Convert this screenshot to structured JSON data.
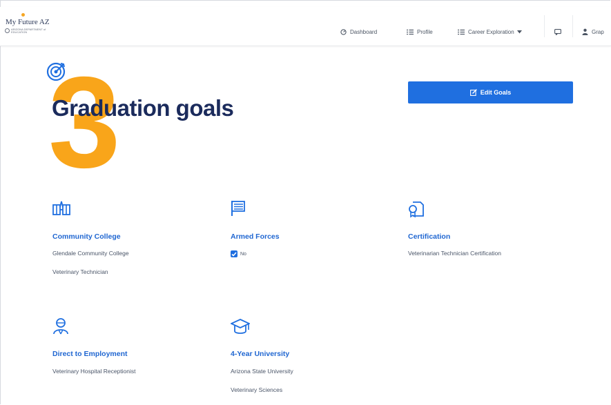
{
  "header": {
    "logo_title": "My Future AZ",
    "logo_subtitle": "ARIZONA DEPARTMENT of EDUCATION",
    "nav": [
      {
        "label": "Dashboard",
        "icon": "dashboard-icon"
      },
      {
        "label": "Profile",
        "icon": "profile-list-icon"
      },
      {
        "label": "Career Exploration",
        "icon": "career-list-icon",
        "dropdown": true
      },
      {
        "label": "",
        "icon": "chat-icon"
      },
      {
        "label": "Grap",
        "icon": "user-icon"
      }
    ]
  },
  "hero": {
    "number": "3",
    "title": "Graduation goals",
    "edit_button": "Edit Goals"
  },
  "goals": [
    {
      "icon": "community-college-icon",
      "title": "Community College",
      "lines": [
        "Glendale Community College",
        "Veterinary Technician"
      ]
    },
    {
      "icon": "armed-forces-flag-icon",
      "title": "Armed Forces",
      "checkbox": {
        "checked": true,
        "label": "No"
      }
    },
    {
      "icon": "certification-icon",
      "title": "Certification",
      "lines": [
        "Veterinarian Technician Certification"
      ]
    },
    {
      "icon": "employment-icon",
      "title": "Direct to Employment",
      "lines": [
        "Veterinary Hospital Receptionist"
      ]
    },
    {
      "icon": "graduation-cap-icon",
      "title": "4-Year University",
      "lines": [
        "Arizona State University",
        "Veterinary Sciences"
      ]
    }
  ],
  "colors": {
    "accent_blue": "#1f6fe0",
    "title_navy": "#1b2b5c",
    "number_orange": "#f9a51a",
    "goal_title_blue": "#1f66d1"
  }
}
